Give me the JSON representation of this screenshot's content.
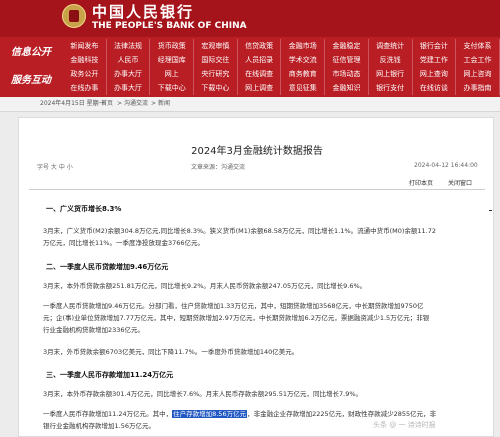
{
  "header": {
    "bank_name_cn": "中国人民银行",
    "bank_name_en": "THE PEOPLE'S BANK OF CHINA",
    "logo_icon": "pboc-emblem-icon"
  },
  "nav": {
    "label_1": "信息公开",
    "label_2": "服务互动",
    "rows": [
      [
        "新闻发布",
        "法律法规",
        "货币政策",
        "宏观审慎",
        "信贷政策",
        "金融市场",
        "金融稳定",
        "调查统计",
        "银行会计",
        "支付体系"
      ],
      [
        "金融科技",
        "人民币",
        "经理国库",
        "国际交往",
        "人员招录",
        "学术交流",
        "征信管理",
        "反洗钱",
        "党建工作",
        "工会工作"
      ],
      [
        "政务公开",
        "办事大厅",
        "网上",
        "央行研究",
        "在线调查",
        "商务教育",
        "市场动态",
        "网上银行",
        "网上查询",
        "网上咨询"
      ],
      [
        "在线办事",
        "办事大厅",
        "下载中心",
        "下载中心",
        "网上调查",
        "意见征集",
        "金融知识",
        "银行支付",
        "在线访谈",
        "办事指南"
      ]
    ]
  },
  "breadcrumb": {
    "date": "2024年4月15日 星期一",
    "sep": "|",
    "home": "首页",
    "arrow": ">",
    "section": "沟通交流",
    "page": "新闻"
  },
  "article": {
    "title": "2024年3月金融统计数据报告",
    "font_size_label": "字号 大 中 小",
    "source": "文章来源：沟通交流",
    "published": "2024-04-12 16:44:00",
    "print_label": "打印本页",
    "close_label": "关闭窗口",
    "sections": [
      {
        "heading": "一、广义货币增长8.3%",
        "paragraphs": [
          "3月末，广义货币(M2)余额304.8万亿元,同比增长8.3%。狭义货币(M1)余额68.58万亿元，同比增长1.1%。流通中货币(M0)余额11.72",
          "万亿元，同比增长11%。一季度净投放现金3766亿元。"
        ]
      },
      {
        "heading": "二、一季度人民币贷款增加9.46万亿元",
        "paragraphs": [
          "3月末，本外币贷款余额251.81万亿元，同比增长9.2%。月末人民币贷款余额247.05万亿元，同比增长9.6%。",
          "一季度人民币贷款增加9.46万亿元。分部门看，住户贷款增加1.33万亿元，其中，短期贷款增加3568亿元，中长期贷款增加9750亿",
          "元；企(事)业单位贷款增加7.77万亿元，其中，短期贷款增加2.97万亿元，中长期贷款增加6.2万亿元，票据融资减少1.5万亿元；非银",
          "行业金融机构贷款增加2336亿元。",
          "3月末，外币贷款余额6703亿美元，同比下降11.7%。一季度外币贷款增加140亿美元。"
        ]
      },
      {
        "heading": "三、一季度人民币存款增加11.24万亿元",
        "paragraphs": [
          "3月末，本外币存款余额301.4万亿元，同比增长7.6%。月末人民币存款余额295.51万亿元，同比增长7.9%。",
          "一季度人民币存款增加11.24万亿元。其中，",
          "住户存款增加8.56万亿元",
          "，非金融企业存款增加2225亿元，财政性存款减少2855亿元，非",
          "银行业金融机构存款增加1.56万亿元。"
        ]
      }
    ]
  },
  "watermark": "头条 @ 一 诗诗时报",
  "colors": {
    "header": "#a4141a",
    "nav": "#b81e24",
    "highlight": "#2157c2"
  }
}
